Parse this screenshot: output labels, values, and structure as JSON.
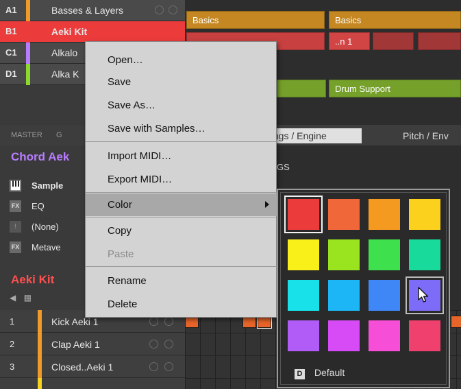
{
  "groups": [
    {
      "id": "A1",
      "name": "Basses & Layers",
      "color": "#f09a2a"
    },
    {
      "id": "B1",
      "name": "Aeki Kit",
      "color": "#ec3b3b"
    },
    {
      "id": "C1",
      "name": "Alkalo",
      "color": "#b87cff"
    },
    {
      "id": "D1",
      "name": "Alka K",
      "color": "#8bd92a"
    }
  ],
  "clips": {
    "a1_1": "Basics",
    "a1_2": "Basics",
    "b1_1": "..n 1",
    "d1_1": "Drum Support"
  },
  "master_bar": {
    "master": "MASTER",
    "group": "G"
  },
  "sound_title": "Chord Aek",
  "tabs": {
    "active": "ttings / Engine",
    "pitch": "Pitch / Env"
  },
  "settings_label": "GS",
  "slots": [
    {
      "badge": "",
      "name": "Sample"
    },
    {
      "badge": "FX",
      "name": "EQ"
    },
    {
      "badge": "!",
      "name": "(None)"
    },
    {
      "badge": "FX",
      "name": "Metave"
    }
  ],
  "kit_title": "Aeki Kit",
  "pads": [
    {
      "id": "1",
      "name": "Kick Aeki 1"
    },
    {
      "id": "2",
      "name": "Clap Aeki 1"
    },
    {
      "id": "3",
      "name": "Closed..Aeki 1"
    }
  ],
  "context_menu": {
    "items": [
      {
        "label": "Open…",
        "enabled": true
      },
      {
        "label": "Save",
        "enabled": true
      },
      {
        "label": "Save As…",
        "enabled": true
      },
      {
        "label": "Save with Samples…",
        "enabled": true
      },
      {
        "label": "Import MIDI…",
        "enabled": true
      },
      {
        "label": "Export MIDI…",
        "enabled": true
      },
      {
        "label": "Color",
        "enabled": true,
        "has_submenu": true,
        "highlighted": true
      },
      {
        "label": "Copy",
        "enabled": true
      },
      {
        "label": "Paste",
        "enabled": false
      },
      {
        "label": "Rename",
        "enabled": true
      },
      {
        "label": "Delete",
        "enabled": true
      }
    ]
  },
  "color_palette": {
    "colors": [
      "#ec3b3b",
      "#f0683a",
      "#f59a20",
      "#fbd11e",
      "#f9f01a",
      "#99e31f",
      "#3ee04e",
      "#18db9b",
      "#18e1e9",
      "#1cb5f5",
      "#3f86f6",
      "#7d6cf8",
      "#b25cf7",
      "#d64bf5",
      "#f64ed6",
      "#f0406d"
    ],
    "selected_index": 0,
    "hover_index": 11,
    "default_badge": "D",
    "default_label": "Default"
  }
}
